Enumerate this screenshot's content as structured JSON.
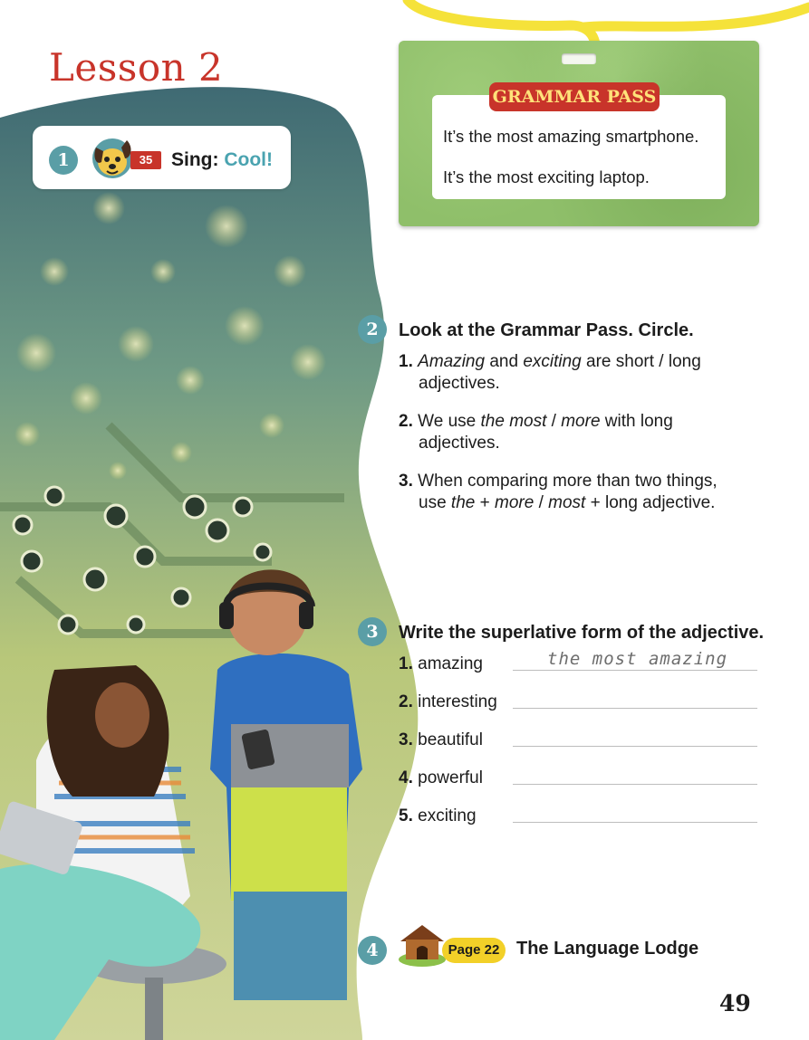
{
  "lesson": {
    "title": "Lesson 2"
  },
  "sing": {
    "number": "1",
    "track": "35",
    "label": "Sing:",
    "song": "Cool!"
  },
  "grammar_pass": {
    "title": "GRAMMAR PASS",
    "lines": [
      "It’s the most amazing smartphone.",
      "It’s the most exciting laptop."
    ]
  },
  "exercise2": {
    "number": "2",
    "heading": "Look at the Grammar Pass. Circle.",
    "items": [
      {
        "num": "1.",
        "pre_i1": "Amazing",
        "mid": " and ",
        "pre_i2": "exciting",
        "rest": " are  short  /  long",
        "line2": "adjectives."
      },
      {
        "num": "2.",
        "pre": "We use  ",
        "opt1": "the most",
        "sep": " / ",
        "opt2": "more",
        "rest": "  with long",
        "line2": "adjectives."
      },
      {
        "num": "3.",
        "pre": "When comparing more than two things,",
        "l2_pre": "use ",
        "l2_the": "the",
        "l2_plus": " +  ",
        "l2_opt1": "more",
        "l2_sep": "  /  ",
        "l2_opt2": "most",
        "l2_rest": "  + long adjective."
      }
    ]
  },
  "exercise3": {
    "number": "3",
    "heading": "Write the superlative form of the adjective.",
    "items": [
      {
        "num": "1.",
        "word": "amazing",
        "answer": "the most amazing"
      },
      {
        "num": "2.",
        "word": "interesting",
        "answer": ""
      },
      {
        "num": "3.",
        "word": "beautiful",
        "answer": ""
      },
      {
        "num": "4.",
        "word": "powerful",
        "answer": ""
      },
      {
        "num": "5.",
        "word": "exciting",
        "answer": ""
      }
    ]
  },
  "exercise4": {
    "number": "4",
    "page_ref": "Page 22",
    "label": "The Language Lodge"
  },
  "page_number": "49",
  "colors": {
    "accent_red": "#c8342a",
    "teal": "#5a9ea6",
    "pass_green": "#8fbf6a",
    "lanyard_yellow": "#f5e23a",
    "badge_yellow": "#f2d028"
  }
}
